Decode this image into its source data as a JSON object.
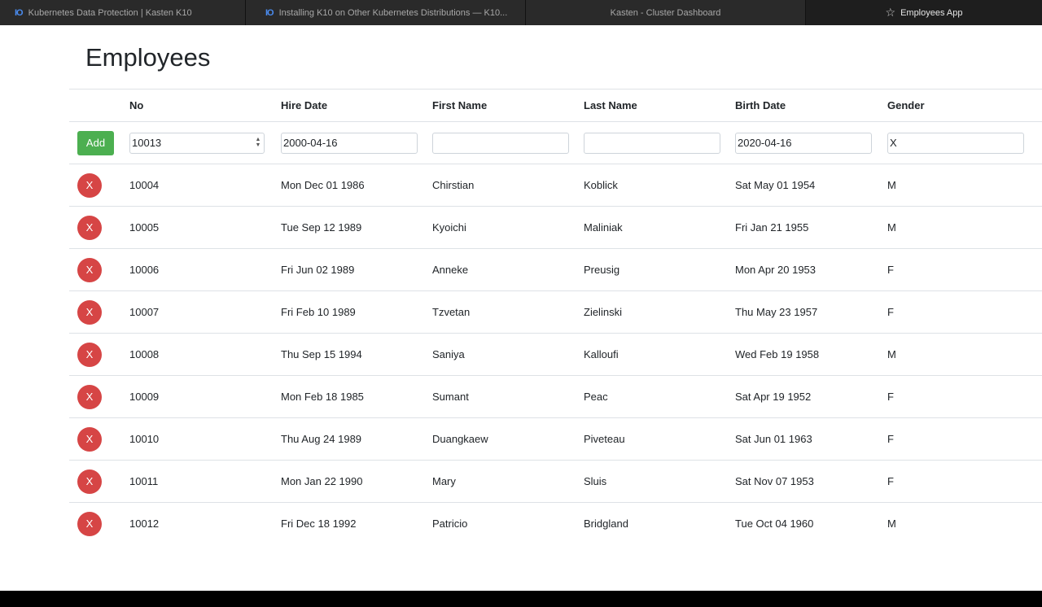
{
  "tabs": [
    {
      "icon": "IO",
      "label": "Kubernetes Data Protection | Kasten K10"
    },
    {
      "icon": "IO",
      "label": "Installing K10 on Other Kubernetes Distributions — K10..."
    },
    {
      "icon": "",
      "label": "Kasten - Cluster Dashboard"
    },
    {
      "icon": "☆",
      "label": "Employees App"
    }
  ],
  "page": {
    "title": "Employees"
  },
  "table": {
    "headers": [
      "No",
      "Hire Date",
      "First Name",
      "Last Name",
      "Birth Date",
      "Gender"
    ],
    "add_row": {
      "button": "Add",
      "no": "10013",
      "hire_date": "2000-04-16",
      "first_name": "",
      "last_name": "",
      "birth_date": "2020-04-16",
      "gender": "X"
    },
    "delete_label": "X",
    "rows": [
      {
        "no": "10004",
        "hire_date": "Mon Dec 01 1986",
        "first_name": "Chirstian",
        "last_name": "Koblick",
        "birth_date": "Sat May 01 1954",
        "gender": "M"
      },
      {
        "no": "10005",
        "hire_date": "Tue Sep 12 1989",
        "first_name": "Kyoichi",
        "last_name": "Maliniak",
        "birth_date": "Fri Jan 21 1955",
        "gender": "M"
      },
      {
        "no": "10006",
        "hire_date": "Fri Jun 02 1989",
        "first_name": "Anneke",
        "last_name": "Preusig",
        "birth_date": "Mon Apr 20 1953",
        "gender": "F"
      },
      {
        "no": "10007",
        "hire_date": "Fri Feb 10 1989",
        "first_name": "Tzvetan",
        "last_name": "Zielinski",
        "birth_date": "Thu May 23 1957",
        "gender": "F"
      },
      {
        "no": "10008",
        "hire_date": "Thu Sep 15 1994",
        "first_name": "Saniya",
        "last_name": "Kalloufi",
        "birth_date": "Wed Feb 19 1958",
        "gender": "M"
      },
      {
        "no": "10009",
        "hire_date": "Mon Feb 18 1985",
        "first_name": "Sumant",
        "last_name": "Peac",
        "birth_date": "Sat Apr 19 1952",
        "gender": "F"
      },
      {
        "no": "10010",
        "hire_date": "Thu Aug 24 1989",
        "first_name": "Duangkaew",
        "last_name": "Piveteau",
        "birth_date": "Sat Jun 01 1963",
        "gender": "F"
      },
      {
        "no": "10011",
        "hire_date": "Mon Jan 22 1990",
        "first_name": "Mary",
        "last_name": "Sluis",
        "birth_date": "Sat Nov 07 1953",
        "gender": "F"
      },
      {
        "no": "10012",
        "hire_date": "Fri Dec 18 1992",
        "first_name": "Patricio",
        "last_name": "Bridgland",
        "birth_date": "Tue Oct 04 1960",
        "gender": "M"
      }
    ]
  },
  "colors": {
    "add_button": "#4caf50",
    "delete_button": "#d64545",
    "tab_icon": "#4a8cf0"
  }
}
